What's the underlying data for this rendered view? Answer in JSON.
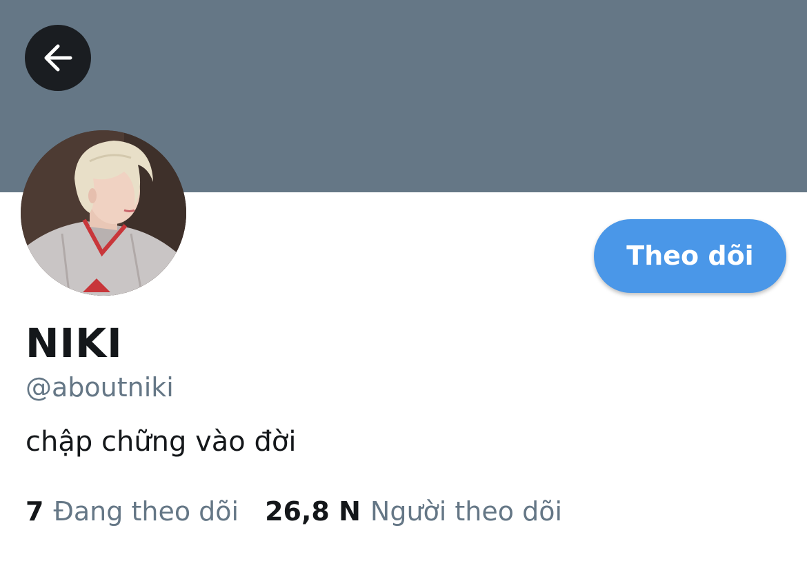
{
  "colors": {
    "banner": "#657786",
    "accent": "#4a97e8",
    "text_primary": "#14171a",
    "text_secondary": "#657786"
  },
  "header": {
    "back_icon": "arrow-left-icon"
  },
  "profile": {
    "display_name": "NIKI",
    "handle": "@aboutniki",
    "bio": "chập chững vào đời",
    "follow_label": "Theo dõi"
  },
  "stats": {
    "following_count": "7",
    "following_label": "Đang theo dõi",
    "followers_count": "26,8 N",
    "followers_label": "Người theo dõi"
  }
}
